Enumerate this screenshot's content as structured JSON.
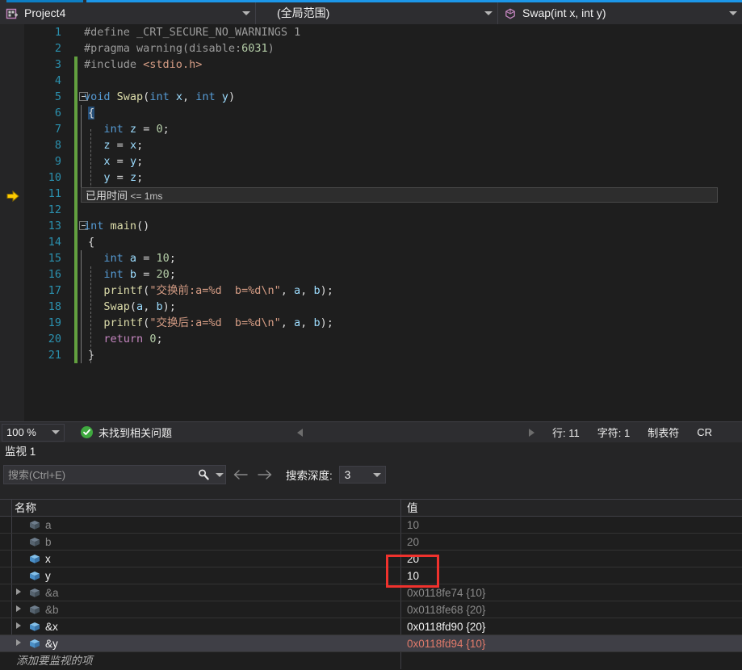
{
  "navbar": {
    "project": {
      "label": "Project4",
      "icon": "project-icon"
    },
    "scope": {
      "label": "(全局范围)"
    },
    "member": {
      "label": "Swap(int x, int y)",
      "icon": "method-cube-icon"
    }
  },
  "editor": {
    "lines": [
      {
        "no": "1",
        "text": "#define _CRT_SECURE_NO_WARNINGS 1"
      },
      {
        "no": "2",
        "text": "#pragma warning(disable:6031)"
      },
      {
        "no": "3",
        "text": "#include <stdio.h>"
      },
      {
        "no": "4",
        "text": ""
      },
      {
        "no": "5",
        "text": "void Swap(int x, int y)"
      },
      {
        "no": "6",
        "text": "{"
      },
      {
        "no": "7",
        "text": "    int z = 0;"
      },
      {
        "no": "8",
        "text": "    z = x;"
      },
      {
        "no": "9",
        "text": "    x = y;"
      },
      {
        "no": "10",
        "text": "    y = z;"
      },
      {
        "no": "11",
        "text": "}"
      },
      {
        "no": "12",
        "text": ""
      },
      {
        "no": "13",
        "text": "int main()"
      },
      {
        "no": "14",
        "text": "{"
      },
      {
        "no": "15",
        "text": "    int a = 10;"
      },
      {
        "no": "16",
        "text": "    int b = 20;"
      },
      {
        "no": "17",
        "text": "    printf(\"交换前:a=%d  b=%d\\n\", a, b);"
      },
      {
        "no": "18",
        "text": "    Swap(a, b);"
      },
      {
        "no": "19",
        "text": "    printf(\"交换后:a=%d  b=%d\\n\", a, b);"
      },
      {
        "no": "20",
        "text": "    return 0;"
      },
      {
        "no": "21",
        "text": "}"
      }
    ],
    "elapsed_tip": {
      "label": "已用时间",
      "value": "<= 1ms"
    },
    "current_line": "11"
  },
  "editor_status": {
    "zoom": "100 %",
    "problems": "未找到相关问题",
    "line": "行: 11",
    "char": "字符: 1",
    "tabs": "制表符",
    "eol": "CR"
  },
  "watch": {
    "title": "监视 1",
    "search_placeholder": "搜索(Ctrl+E)",
    "search_value": "",
    "depth_label": "搜索深度:",
    "depth_value": "3",
    "columns": {
      "name": "名称",
      "value": "值"
    },
    "rows": [
      {
        "name": "a",
        "value": "10",
        "expandable": false,
        "state": "dim",
        "value_state": "dim",
        "selected": false
      },
      {
        "name": "b",
        "value": "20",
        "expandable": false,
        "state": "dim",
        "value_state": "dim",
        "selected": false
      },
      {
        "name": "x",
        "value": "20",
        "expandable": false,
        "state": "active",
        "value_state": "active",
        "selected": false
      },
      {
        "name": "y",
        "value": "10",
        "expandable": false,
        "state": "active",
        "value_state": "active",
        "selected": false
      },
      {
        "name": "&a",
        "value": "0x0118fe74 {10}",
        "expandable": true,
        "state": "dim",
        "value_state": "dim",
        "selected": false
      },
      {
        "name": "&b",
        "value": "0x0118fe68 {20}",
        "expandable": true,
        "state": "dim",
        "value_state": "dim",
        "selected": false
      },
      {
        "name": "&x",
        "value": "0x0118fd90 {20}",
        "expandable": true,
        "state": "active",
        "value_state": "active",
        "selected": false
      },
      {
        "name": "&y",
        "value": "0x0118fd94 {10}",
        "expandable": true,
        "state": "active",
        "value_state": "changed",
        "selected": true
      }
    ],
    "add_row_placeholder": "添加要监视的项"
  },
  "colors": {
    "accent": "#1c97ea",
    "annotation": "#f0322d",
    "saved_changebar": "#62a03f",
    "step_arrow": "#ffcc00",
    "ok_green": "#3fa93f"
  }
}
